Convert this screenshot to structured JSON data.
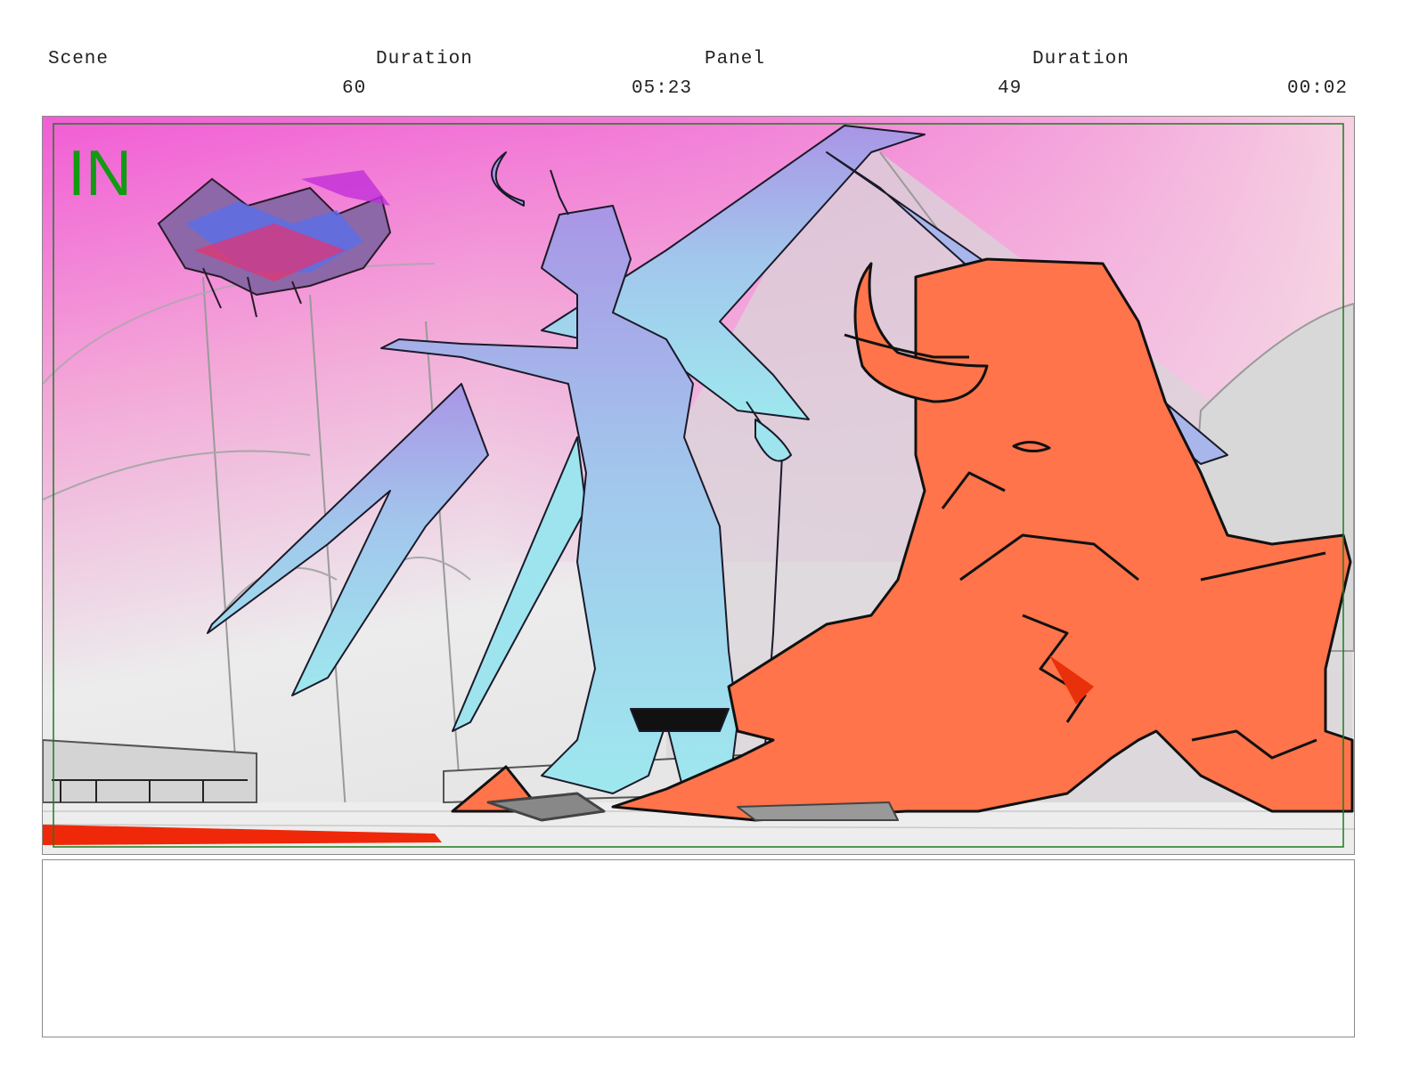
{
  "header": {
    "scene_label": "Scene",
    "scene_duration_label": "Duration",
    "panel_label": "Panel",
    "panel_duration_label": "Duration",
    "scene_value": "60",
    "scene_duration_value": "05:23",
    "panel_value": "49",
    "panel_duration_value": "00:02"
  },
  "panel": {
    "in_marker": "IN",
    "safe_frame_color": "#1f7a1f",
    "sky_colors": [
      "#f25cd6",
      "#f3a9d8",
      "#eeeeee"
    ],
    "winged_figure_colors": [
      "#a99ae6",
      "#9ee6ee"
    ],
    "crouching_figure_color": "#ff744a",
    "accent_red": "#f0280a"
  },
  "notes": {
    "text": ""
  }
}
